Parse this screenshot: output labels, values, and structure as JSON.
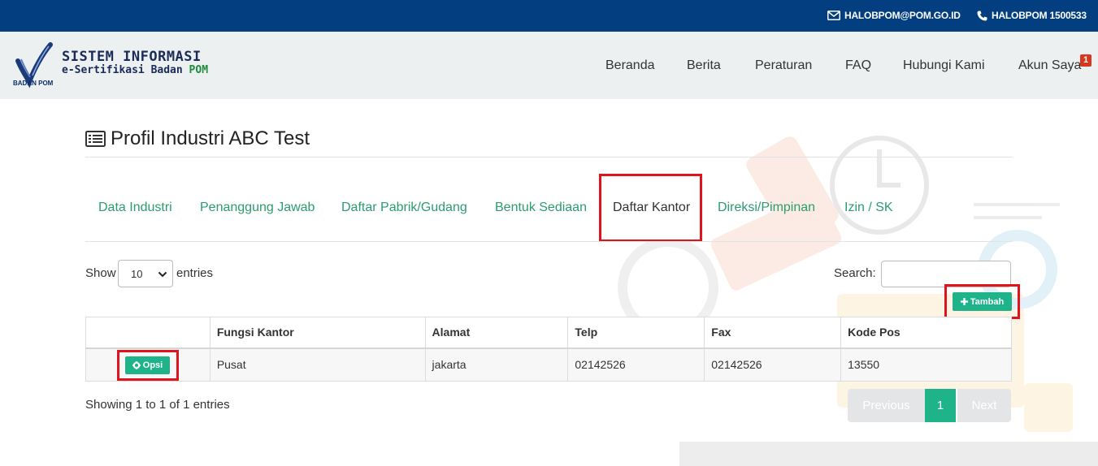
{
  "topbar": {
    "email": "HALOBPOM@POM.GO.ID",
    "phone": "HALOBPOM 1500533",
    "email_icon": "envelope-icon",
    "phone_icon": "phone-icon"
  },
  "brand": {
    "logo_caption": "BADAN POM",
    "line1": "SISTEM INFORMASI",
    "line2_prefix": "e-Sertifikasi Badan ",
    "line2_highlight": "POM"
  },
  "nav": {
    "items": [
      "Beranda",
      "Berita",
      "Peraturan",
      "FAQ",
      "Hubungi Kami",
      "Akun Saya"
    ],
    "notification_count": "1"
  },
  "page": {
    "title": "Profil Industri ABC Test",
    "title_icon": "list-alt-icon"
  },
  "tabs": {
    "items": [
      "Data Industri",
      "Penanggung Jawab",
      "Daftar Pabrik/Gudang",
      "Bentuk Sediaan",
      "Daftar Kantor",
      "Direksi/Pimpinan",
      "Izin / SK"
    ],
    "active": "Daftar Kantor"
  },
  "controls": {
    "show_label": "Show",
    "entries_label": "entries",
    "length_value": "10",
    "search_label": "Search:",
    "search_value": "",
    "add_button": "Tambah"
  },
  "table": {
    "columns": [
      "",
      "Fungsi Kantor",
      "Alamat",
      "Telp",
      "Fax",
      "Kode Pos"
    ],
    "rows": [
      {
        "action": "Opsi",
        "fungsi": "Pusat",
        "alamat": "jakarta",
        "telp": "02142526",
        "fax": "02142526",
        "kode_pos": "13550"
      }
    ]
  },
  "footer": {
    "info": "Showing 1 to 1 of 1 entries",
    "prev": "Previous",
    "current_page": "1",
    "next": "Next"
  },
  "colors": {
    "topbar": "#033e80",
    "accent_green": "#1fb38a",
    "tab_link": "#2c9c6f",
    "highlight_red": "#e0141c"
  }
}
